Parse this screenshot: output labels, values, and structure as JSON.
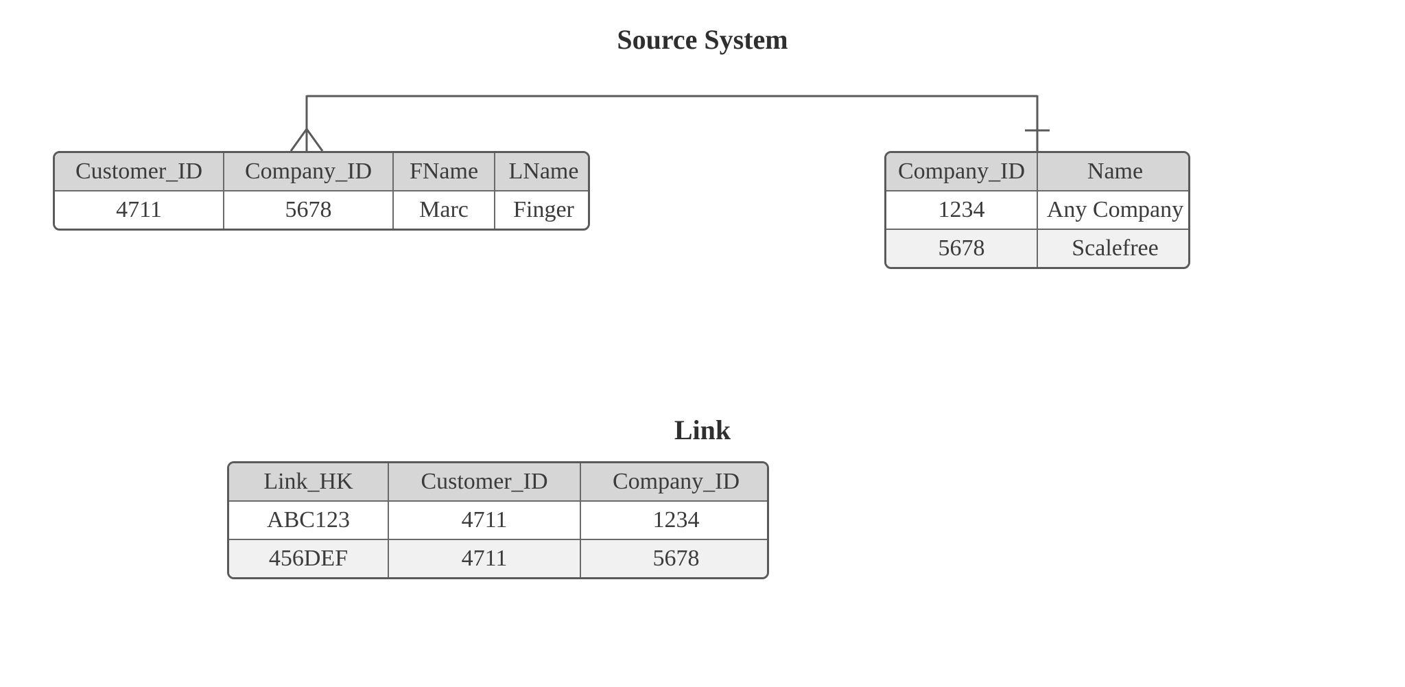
{
  "titles": {
    "source": "Source System",
    "link": "Link"
  },
  "customer_table": {
    "headers": [
      "Customer_ID",
      "Company_ID",
      "FName",
      "LName"
    ],
    "rows": [
      [
        "4711",
        "5678",
        "Marc",
        "Finger"
      ]
    ]
  },
  "company_table": {
    "headers": [
      "Company_ID",
      "Name"
    ],
    "rows": [
      [
        "1234",
        "Any Company"
      ],
      [
        "5678",
        "Scalefree"
      ]
    ]
  },
  "link_table": {
    "headers": [
      "Link_HK",
      "Customer_ID",
      "Company_ID"
    ],
    "rows": [
      [
        "ABC123",
        "4711",
        "1234"
      ],
      [
        "456DEF",
        "4711",
        "5678"
      ]
    ]
  }
}
